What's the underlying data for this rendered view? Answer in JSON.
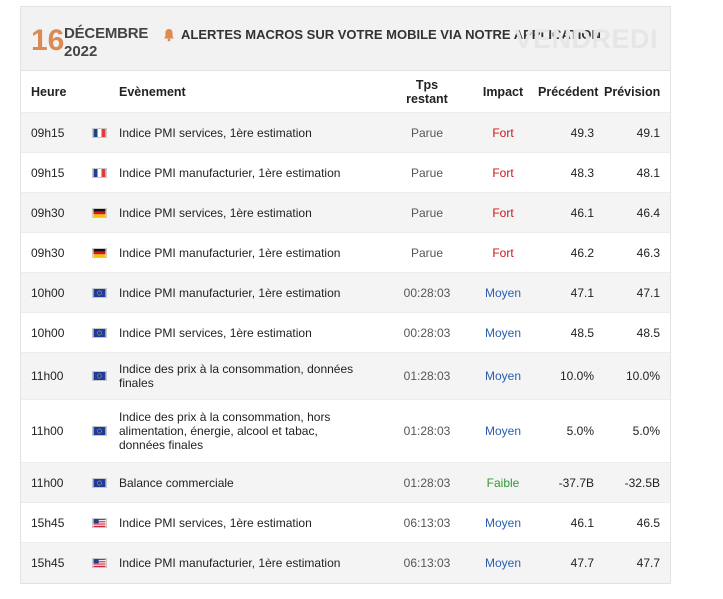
{
  "header": {
    "day": "16",
    "month": "DÉCEMBRE",
    "year": "2022",
    "alert_text": "ALERTES MACROS SUR VOTRE MOBILE VIA NOTRE APPLICATION",
    "weekday": "VENDREDI"
  },
  "columns": {
    "heure": "Heure",
    "evenement": "Evènement",
    "tps_line1": "Tps",
    "tps_line2": "restant",
    "impact": "Impact",
    "precedent": "Précédent",
    "prevision": "Prévision"
  },
  "colors": {
    "accent_day": "#d98a55",
    "fort": "#c8161d",
    "moyen": "#2a5db0",
    "faible": "#2e9a3a"
  },
  "rows": [
    {
      "time": "09h15",
      "country": "fr",
      "event": "Indice PMI services, 1ère estimation",
      "remaining": "Parue",
      "impact": "Fort",
      "previous": "49.3",
      "forecast": "49.1"
    },
    {
      "time": "09h15",
      "country": "fr",
      "event": "Indice PMI manufacturier, 1ère estimation",
      "remaining": "Parue",
      "impact": "Fort",
      "previous": "48.3",
      "forecast": "48.1"
    },
    {
      "time": "09h30",
      "country": "de",
      "event": "Indice PMI services, 1ère estimation",
      "remaining": "Parue",
      "impact": "Fort",
      "previous": "46.1",
      "forecast": "46.4"
    },
    {
      "time": "09h30",
      "country": "de",
      "event": "Indice PMI manufacturier, 1ère estimation",
      "remaining": "Parue",
      "impact": "Fort",
      "previous": "46.2",
      "forecast": "46.3"
    },
    {
      "time": "10h00",
      "country": "eu",
      "event": "Indice PMI manufacturier, 1ère estimation",
      "remaining": "00:28:03",
      "impact": "Moyen",
      "previous": "47.1",
      "forecast": "47.1"
    },
    {
      "time": "10h00",
      "country": "eu",
      "event": "Indice PMI services, 1ère estimation",
      "remaining": "00:28:03",
      "impact": "Moyen",
      "previous": "48.5",
      "forecast": "48.5"
    },
    {
      "time": "11h00",
      "country": "eu",
      "event": "Indice des prix à la consommation, données finales",
      "remaining": "01:28:03",
      "impact": "Moyen",
      "previous": "10.0%",
      "forecast": "10.0%"
    },
    {
      "time": "11h00",
      "country": "eu",
      "event": "Indice des prix à la consommation, hors alimentation, énergie, alcool et tabac, données finales",
      "remaining": "01:28:03",
      "impact": "Moyen",
      "previous": "5.0%",
      "forecast": "5.0%"
    },
    {
      "time": "11h00",
      "country": "eu",
      "event": "Balance commerciale",
      "remaining": "01:28:03",
      "impact": "Faible",
      "previous": "-37.7B",
      "forecast": "-32.5B"
    },
    {
      "time": "15h45",
      "country": "us",
      "event": "Indice PMI services, 1ère estimation",
      "remaining": "06:13:03",
      "impact": "Moyen",
      "previous": "46.1",
      "forecast": "46.5"
    },
    {
      "time": "15h45",
      "country": "us",
      "event": "Indice PMI manufacturier, 1ère estimation",
      "remaining": "06:13:03",
      "impact": "Moyen",
      "previous": "47.7",
      "forecast": "47.7"
    }
  ]
}
